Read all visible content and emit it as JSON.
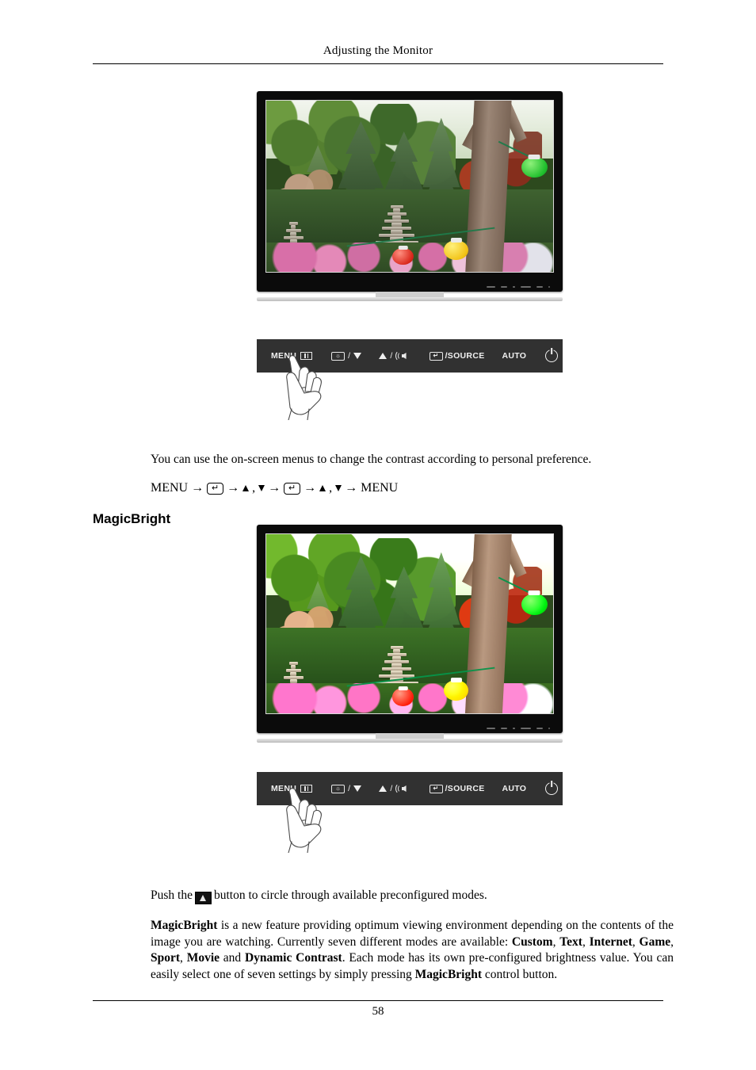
{
  "document": {
    "header_title": "Adjusting the Monitor",
    "page_number": "58"
  },
  "contrast_section": {
    "description": "You can use the on-screen menus to change the contrast according to personal preference.",
    "nav_sequence": {
      "start_label": "MENU",
      "end_label": "MENU",
      "enter_glyph": "↵",
      "arrow_glyph": "→",
      "comma": ",",
      "up_name": "up-arrow",
      "down_name": "down-arrow"
    }
  },
  "magicbright_section": {
    "title": "MagicBright",
    "push_line_before": "Push the",
    "push_line_after": "button to circle through available preconfigured modes.",
    "paragraph": {
      "part1_bold": "MagicBright",
      "part2": " is a new feature providing optimum viewing environment depending on the contents of the image you are watching. Currently seven different modes are available: ",
      "mode1": "Custom",
      "sep1": ", ",
      "mode2": "Text",
      "sep2": ", ",
      "mode3": "Internet",
      "sep3": ", ",
      "mode4": "Game",
      "sep4": ", ",
      "mode5": "Sport",
      "sep5": ", ",
      "mode6": "Movie",
      "sep6": " and ",
      "mode7": "Dynamic Contrast",
      "part3": ". Each mode has its own pre-configured brightness value. You can easily select one of seven settings by simply pressing ",
      "part4_bold": "MagicBright",
      "part5": " control button."
    }
  },
  "control_panel": {
    "menu_label": "MENU",
    "brightness_label": "/",
    "brightness_down": "▼",
    "volume_up": "▲",
    "volume_sep": "/",
    "source_label": "/SOURCE",
    "auto_label": "AUTO",
    "power_name": "power-button",
    "led_color": "#1a82e2",
    "panel_color": "#313131"
  },
  "monitor_image": {
    "caption_alt": "Monitor displaying a garden scene with stone pagodas, trees and paper lanterns",
    "bezel_color": "#0b0b0b",
    "stand_color": "#cfcfcf"
  }
}
